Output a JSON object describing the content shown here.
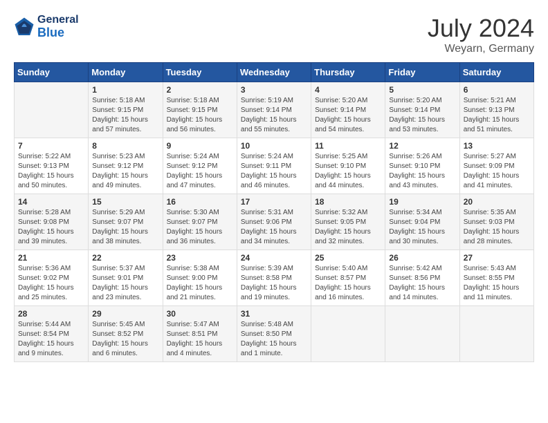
{
  "header": {
    "logo_line1": "General",
    "logo_line2": "Blue",
    "title": "July 2024",
    "subtitle": "Weyarn, Germany"
  },
  "days_of_week": [
    "Sunday",
    "Monday",
    "Tuesday",
    "Wednesday",
    "Thursday",
    "Friday",
    "Saturday"
  ],
  "weeks": [
    [
      {
        "day": "",
        "info": ""
      },
      {
        "day": "1",
        "info": "Sunrise: 5:18 AM\nSunset: 9:15 PM\nDaylight: 15 hours\nand 57 minutes."
      },
      {
        "day": "2",
        "info": "Sunrise: 5:18 AM\nSunset: 9:15 PM\nDaylight: 15 hours\nand 56 minutes."
      },
      {
        "day": "3",
        "info": "Sunrise: 5:19 AM\nSunset: 9:14 PM\nDaylight: 15 hours\nand 55 minutes."
      },
      {
        "day": "4",
        "info": "Sunrise: 5:20 AM\nSunset: 9:14 PM\nDaylight: 15 hours\nand 54 minutes."
      },
      {
        "day": "5",
        "info": "Sunrise: 5:20 AM\nSunset: 9:14 PM\nDaylight: 15 hours\nand 53 minutes."
      },
      {
        "day": "6",
        "info": "Sunrise: 5:21 AM\nSunset: 9:13 PM\nDaylight: 15 hours\nand 51 minutes."
      }
    ],
    [
      {
        "day": "7",
        "info": "Sunrise: 5:22 AM\nSunset: 9:13 PM\nDaylight: 15 hours\nand 50 minutes."
      },
      {
        "day": "8",
        "info": "Sunrise: 5:23 AM\nSunset: 9:12 PM\nDaylight: 15 hours\nand 49 minutes."
      },
      {
        "day": "9",
        "info": "Sunrise: 5:24 AM\nSunset: 9:12 PM\nDaylight: 15 hours\nand 47 minutes."
      },
      {
        "day": "10",
        "info": "Sunrise: 5:24 AM\nSunset: 9:11 PM\nDaylight: 15 hours\nand 46 minutes."
      },
      {
        "day": "11",
        "info": "Sunrise: 5:25 AM\nSunset: 9:10 PM\nDaylight: 15 hours\nand 44 minutes."
      },
      {
        "day": "12",
        "info": "Sunrise: 5:26 AM\nSunset: 9:10 PM\nDaylight: 15 hours\nand 43 minutes."
      },
      {
        "day": "13",
        "info": "Sunrise: 5:27 AM\nSunset: 9:09 PM\nDaylight: 15 hours\nand 41 minutes."
      }
    ],
    [
      {
        "day": "14",
        "info": "Sunrise: 5:28 AM\nSunset: 9:08 PM\nDaylight: 15 hours\nand 39 minutes."
      },
      {
        "day": "15",
        "info": "Sunrise: 5:29 AM\nSunset: 9:07 PM\nDaylight: 15 hours\nand 38 minutes."
      },
      {
        "day": "16",
        "info": "Sunrise: 5:30 AM\nSunset: 9:07 PM\nDaylight: 15 hours\nand 36 minutes."
      },
      {
        "day": "17",
        "info": "Sunrise: 5:31 AM\nSunset: 9:06 PM\nDaylight: 15 hours\nand 34 minutes."
      },
      {
        "day": "18",
        "info": "Sunrise: 5:32 AM\nSunset: 9:05 PM\nDaylight: 15 hours\nand 32 minutes."
      },
      {
        "day": "19",
        "info": "Sunrise: 5:34 AM\nSunset: 9:04 PM\nDaylight: 15 hours\nand 30 minutes."
      },
      {
        "day": "20",
        "info": "Sunrise: 5:35 AM\nSunset: 9:03 PM\nDaylight: 15 hours\nand 28 minutes."
      }
    ],
    [
      {
        "day": "21",
        "info": "Sunrise: 5:36 AM\nSunset: 9:02 PM\nDaylight: 15 hours\nand 25 minutes."
      },
      {
        "day": "22",
        "info": "Sunrise: 5:37 AM\nSunset: 9:01 PM\nDaylight: 15 hours\nand 23 minutes."
      },
      {
        "day": "23",
        "info": "Sunrise: 5:38 AM\nSunset: 9:00 PM\nDaylight: 15 hours\nand 21 minutes."
      },
      {
        "day": "24",
        "info": "Sunrise: 5:39 AM\nSunset: 8:58 PM\nDaylight: 15 hours\nand 19 minutes."
      },
      {
        "day": "25",
        "info": "Sunrise: 5:40 AM\nSunset: 8:57 PM\nDaylight: 15 hours\nand 16 minutes."
      },
      {
        "day": "26",
        "info": "Sunrise: 5:42 AM\nSunset: 8:56 PM\nDaylight: 15 hours\nand 14 minutes."
      },
      {
        "day": "27",
        "info": "Sunrise: 5:43 AM\nSunset: 8:55 PM\nDaylight: 15 hours\nand 11 minutes."
      }
    ],
    [
      {
        "day": "28",
        "info": "Sunrise: 5:44 AM\nSunset: 8:54 PM\nDaylight: 15 hours\nand 9 minutes."
      },
      {
        "day": "29",
        "info": "Sunrise: 5:45 AM\nSunset: 8:52 PM\nDaylight: 15 hours\nand 6 minutes."
      },
      {
        "day": "30",
        "info": "Sunrise: 5:47 AM\nSunset: 8:51 PM\nDaylight: 15 hours\nand 4 minutes."
      },
      {
        "day": "31",
        "info": "Sunrise: 5:48 AM\nSunset: 8:50 PM\nDaylight: 15 hours\nand 1 minute."
      },
      {
        "day": "",
        "info": ""
      },
      {
        "day": "",
        "info": ""
      },
      {
        "day": "",
        "info": ""
      }
    ]
  ]
}
